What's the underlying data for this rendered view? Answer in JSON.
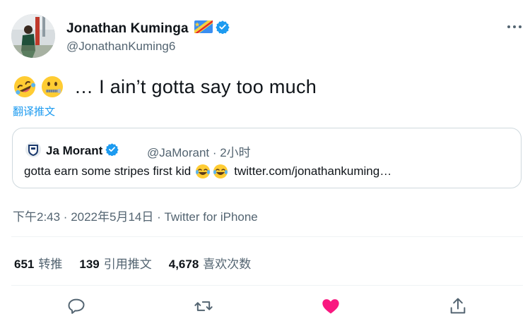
{
  "author": {
    "name": "Jonathan Kuminga",
    "handle": "@JonathanKuming6"
  },
  "tweet": {
    "text": "… I ain’t gotta say too much",
    "translate_label": "翻译推文"
  },
  "quote": {
    "name": "Ja Morant",
    "handle_time": "@JaMorant · 2小时",
    "text": "gotta earn some stripes first kid",
    "link": "twitter.com/jonathankuming…"
  },
  "meta": {
    "timestamp_source": "下午2:43 · 2022年5月14日 · Twitter for iPhone"
  },
  "stats": [
    {
      "count": "651",
      "label": "转推"
    },
    {
      "count": "139",
      "label": "引用推文"
    },
    {
      "count": "4,678",
      "label": "喜欢次数"
    }
  ],
  "colors": {
    "accent": "#1d9bf0",
    "like": "#f91880",
    "secondary_text": "#536471",
    "border": "#cfd9de"
  },
  "icons": {
    "reply": "reply-icon",
    "retweet": "retweet-icon",
    "like": "heart-icon",
    "share": "share-icon",
    "more": "more-icon",
    "verified": "verified-icon"
  }
}
